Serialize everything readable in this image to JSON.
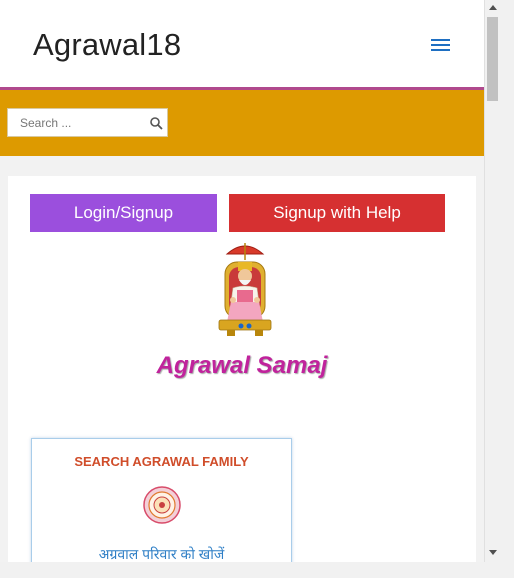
{
  "header": {
    "site_title": "Agrawal18",
    "menu_icon": "hamburger-menu-icon"
  },
  "search": {
    "placeholder": "Search ...",
    "icon": "search-icon"
  },
  "buttons": {
    "login_label": "Login/Signup",
    "help_label": "Signup with Help"
  },
  "hero": {
    "title": "Agrawal Samaj",
    "image": "agrasen-maharaj-idol"
  },
  "family_card": {
    "title": "SEARCH AGRAWAL FAMILY",
    "emblem": "agrawal-emblem-icon",
    "subtitle": "अग्रवाल परिवार को खोजें"
  },
  "colors": {
    "header_line": "#b0498d",
    "search_band": "#dd9a00",
    "login_button": "#9b4fdd",
    "help_button": "#d63031",
    "title_text": "#c0239c",
    "menu_icon": "#1e6fc2"
  }
}
